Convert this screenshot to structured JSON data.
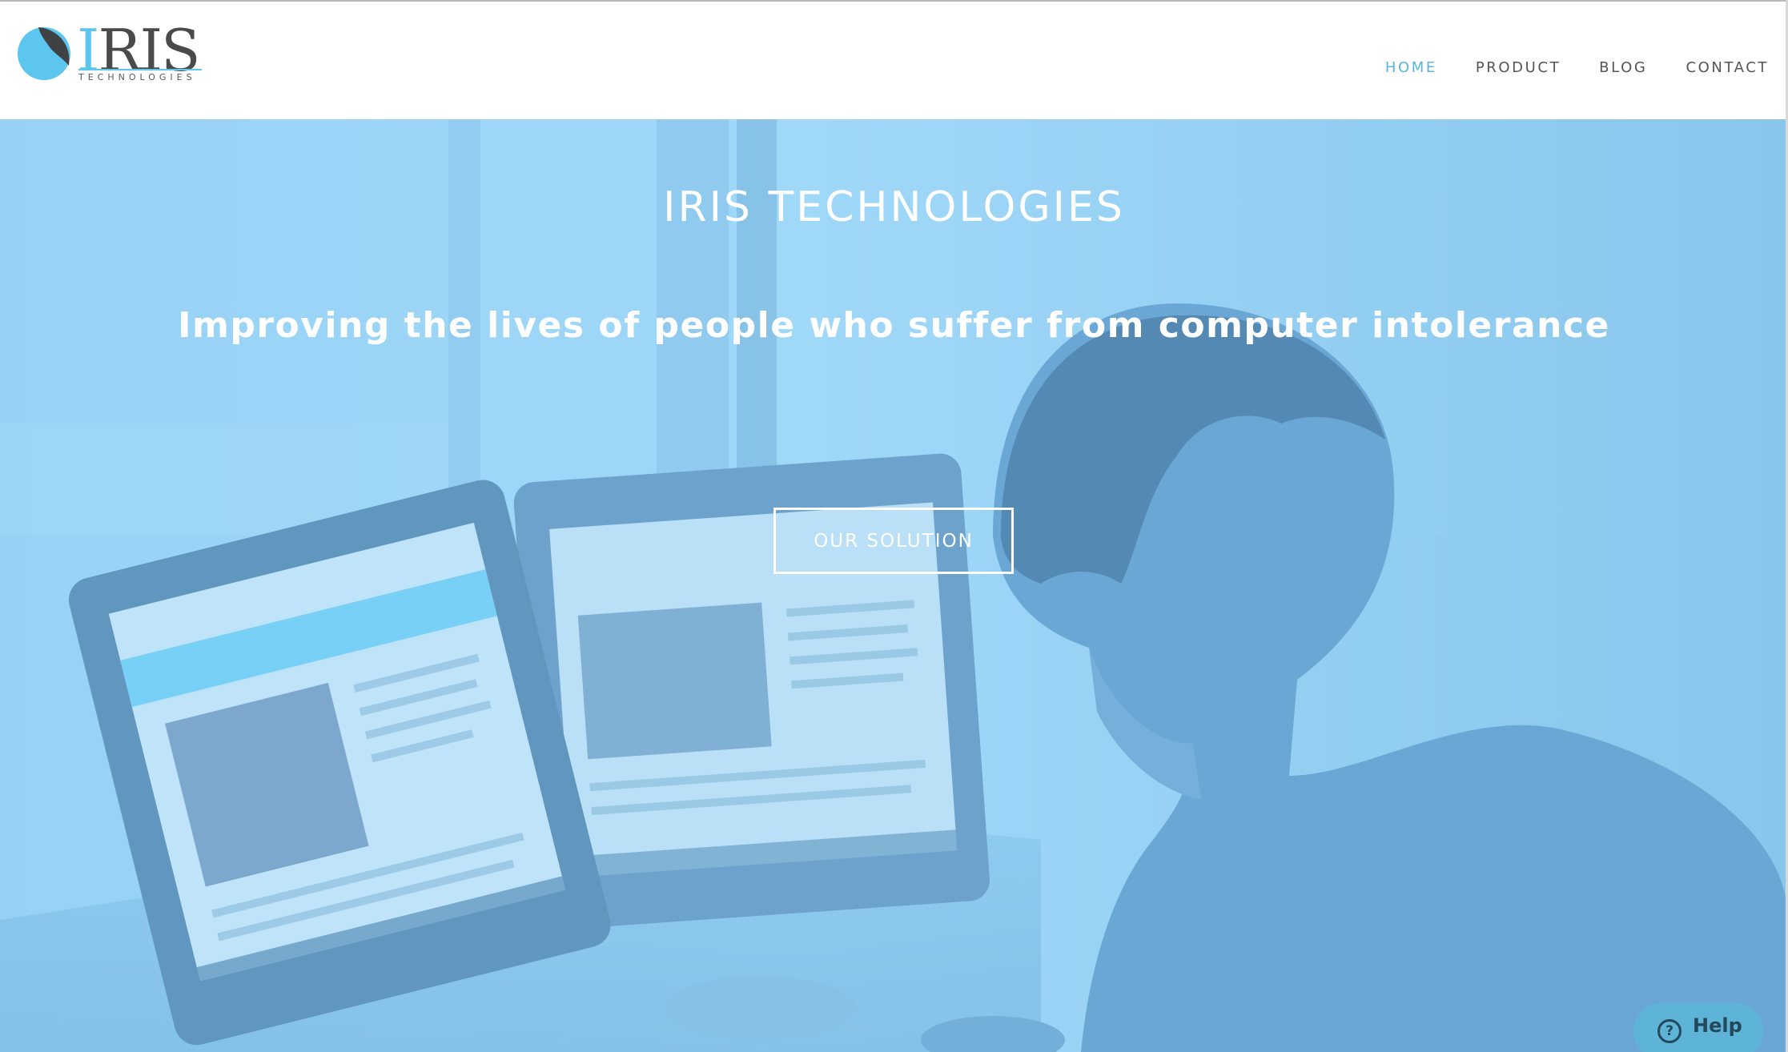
{
  "colors": {
    "accent": "#5ab4dc",
    "logo_blue": "#5cc6ef",
    "hero_tint": "#8fcdf2",
    "nav_text": "#555555"
  },
  "logo": {
    "text": "IRIS",
    "subtext": "TECHNOLOGIES",
    "icon": "iris-drop-logo-icon"
  },
  "nav": {
    "items": [
      {
        "label": "HOME",
        "active": true
      },
      {
        "label": "PRODUCT",
        "active": false
      },
      {
        "label": "BLOG",
        "active": false
      },
      {
        "label": "CONTACT",
        "active": false
      }
    ]
  },
  "hero": {
    "title": "IRIS TECHNOLOGIES",
    "subtitle": "Improving the lives of people who suffer from computer intolerance",
    "cta_label": "OUR SOLUTION"
  },
  "help": {
    "label": "Help",
    "icon": "question-circle-icon"
  }
}
